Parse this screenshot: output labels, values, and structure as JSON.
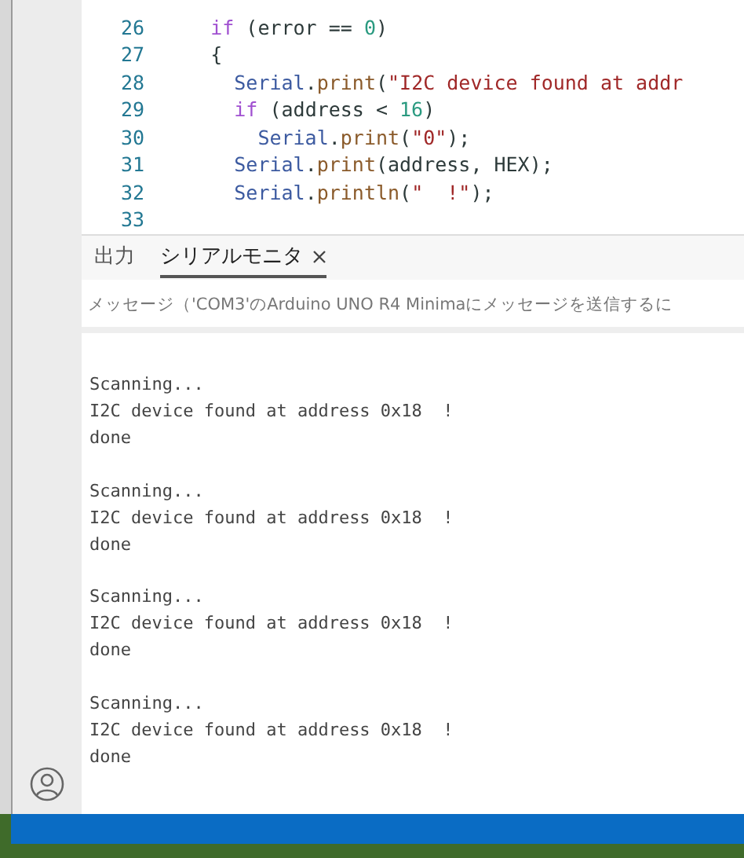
{
  "editor": {
    "lines": [
      {
        "number": "26",
        "tokens": [
          {
            "kind": "keyword",
            "text": "    if"
          },
          {
            "kind": "plain",
            "text": " (error == "
          },
          {
            "kind": "number",
            "text": "0"
          },
          {
            "kind": "plain",
            "text": ")"
          }
        ]
      },
      {
        "number": "27",
        "tokens": [
          {
            "kind": "plain",
            "text": "    {"
          }
        ]
      },
      {
        "number": "28",
        "tokens": [
          {
            "kind": "object",
            "text": "      Serial"
          },
          {
            "kind": "plain",
            "text": "."
          },
          {
            "kind": "method",
            "text": "print"
          },
          {
            "kind": "plain",
            "text": "("
          },
          {
            "kind": "string",
            "text": "\"I2C device found at addr"
          }
        ]
      },
      {
        "number": "29",
        "tokens": [
          {
            "kind": "keyword",
            "text": "      if"
          },
          {
            "kind": "plain",
            "text": " (address < "
          },
          {
            "kind": "number",
            "text": "16"
          },
          {
            "kind": "plain",
            "text": ")"
          }
        ]
      },
      {
        "number": "30",
        "tokens": [
          {
            "kind": "object",
            "text": "        Serial"
          },
          {
            "kind": "plain",
            "text": "."
          },
          {
            "kind": "method",
            "text": "print"
          },
          {
            "kind": "plain",
            "text": "("
          },
          {
            "kind": "string",
            "text": "\"0\""
          },
          {
            "kind": "plain",
            "text": ");"
          }
        ]
      },
      {
        "number": "31",
        "tokens": [
          {
            "kind": "object",
            "text": "      Serial"
          },
          {
            "kind": "plain",
            "text": "."
          },
          {
            "kind": "method",
            "text": "print"
          },
          {
            "kind": "plain",
            "text": "(address, HEX);"
          }
        ]
      },
      {
        "number": "32",
        "tokens": [
          {
            "kind": "object",
            "text": "      Serial"
          },
          {
            "kind": "plain",
            "text": "."
          },
          {
            "kind": "method",
            "text": "println"
          },
          {
            "kind": "plain",
            "text": "("
          },
          {
            "kind": "string",
            "text": "\"  !\""
          },
          {
            "kind": "plain",
            "text": ");"
          }
        ]
      },
      {
        "number": "33"
      }
    ]
  },
  "panel_tabs": [
    {
      "label": "出力",
      "selected": false,
      "closable": false
    },
    {
      "label": "シリアルモニタ",
      "selected": true,
      "closable": true
    }
  ],
  "message_field": {
    "placeholder": "メッセージ（'COM3'のArduino UNO R4 Minimaにメッセージを送信するに"
  },
  "serial_output": [
    {
      "lines": [
        "Scanning...",
        "I2C device found at address 0x18  !",
        "done"
      ]
    },
    {
      "lines": [
        "Scanning...",
        "I2C device found at address 0x18  !",
        "done"
      ]
    },
    {
      "lines": [
        "Scanning...",
        "I2C device found at address 0x18  !",
        "done"
      ]
    },
    {
      "lines": [
        "Scanning...",
        "I2C device found at address 0x18  !",
        "done"
      ]
    }
  ]
}
